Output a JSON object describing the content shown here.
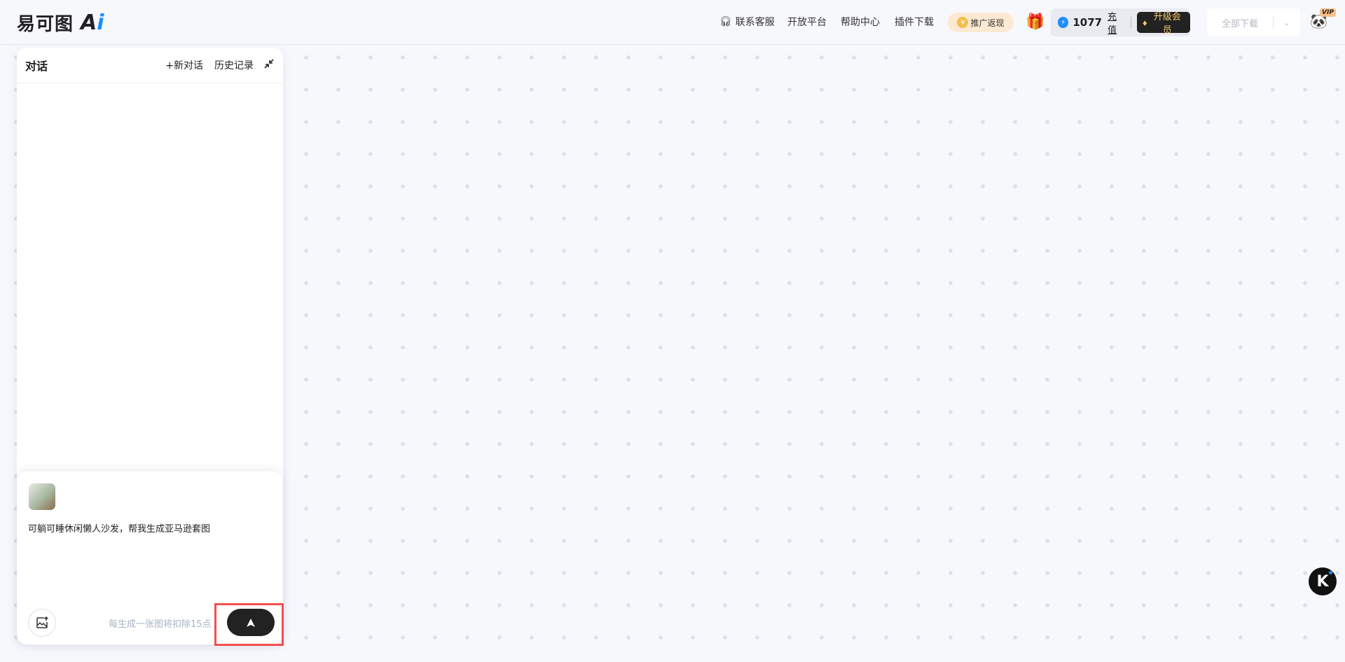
{
  "brand": {
    "logo_cn": "易可图",
    "logo_ai": "A",
    "logo_i": "i"
  },
  "header": {
    "nav": [
      "联系客服",
      "开放平台",
      "帮助中心",
      "插件下载"
    ],
    "promo": "推广返现",
    "credits": "1077",
    "recharge": "充值",
    "upgrade": "升级会员",
    "download_all": "全部下载",
    "vip": "VIP"
  },
  "panel": {
    "title": "对话",
    "new_chat": "+新对话",
    "history": "历史记录",
    "prompt": "可躺可睡休闲懒人沙发，帮我生成亚马逊套图",
    "hint": "每生成一张图将扣除15点"
  },
  "float": {
    "k": "K"
  }
}
